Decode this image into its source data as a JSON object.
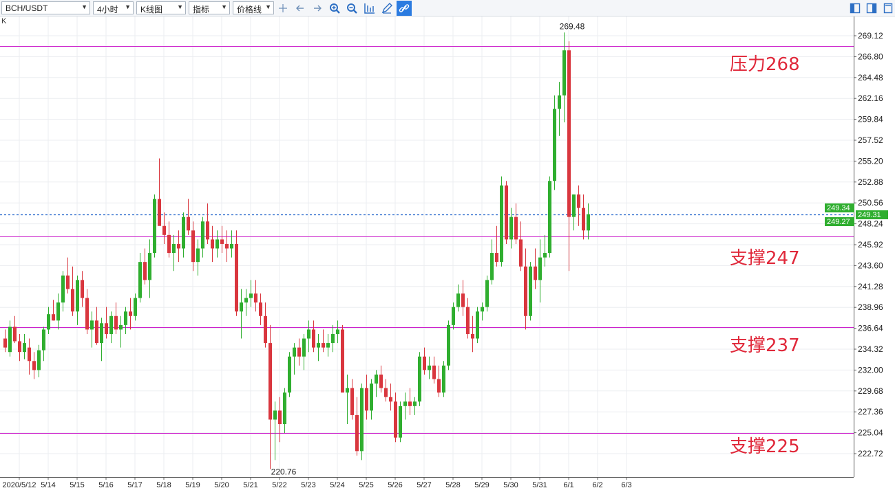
{
  "toolbar": {
    "symbol": "BCH/USDT",
    "interval": "4小时",
    "chart_style": "K线图",
    "indicator": "指标",
    "price_line": "价格线"
  },
  "panel_label": "K",
  "colors": {
    "up": "#2fae2f",
    "down": "#d9363e",
    "hline": "#cc22cc",
    "annotation": "#e0283a",
    "last_price": "#1a5fc9"
  },
  "chart_data": {
    "type": "candlestick",
    "title": "",
    "symbol": "BCH/USDT",
    "interval": "4小时",
    "ylim": [
      220.76,
      270.5
    ],
    "y_ticks": [
      "269.12",
      "266.80",
      "264.48",
      "262.16",
      "259.84",
      "257.52",
      "255.20",
      "252.88",
      "250.56",
      "248.24",
      "245.92",
      "243.60",
      "241.28",
      "238.96",
      "236.64",
      "234.32",
      "232.00",
      "229.68",
      "227.36",
      "225.04",
      "222.72"
    ],
    "x_ticks": [
      {
        "label": "2020/5/12",
        "index": 3
      },
      {
        "label": "5/14",
        "index": 9
      },
      {
        "label": "5/15",
        "index": 15
      },
      {
        "label": "5/16",
        "index": 21
      },
      {
        "label": "5/17",
        "index": 27
      },
      {
        "label": "5/18",
        "index": 33
      },
      {
        "label": "5/19",
        "index": 39
      },
      {
        "label": "5/20",
        "index": 45
      },
      {
        "label": "5/21",
        "index": 51
      },
      {
        "label": "5/22",
        "index": 57
      },
      {
        "label": "5/23",
        "index": 63
      },
      {
        "label": "5/24",
        "index": 69
      },
      {
        "label": "5/25",
        "index": 75
      },
      {
        "label": "5/26",
        "index": 81
      },
      {
        "label": "5/27",
        "index": 87
      },
      {
        "label": "5/28",
        "index": 93
      },
      {
        "label": "5/29",
        "index": 99
      },
      {
        "label": "5/30",
        "index": 105
      },
      {
        "label": "5/31",
        "index": 111
      },
      {
        "label": "6/1",
        "index": 117
      },
      {
        "label": "6/2",
        "index": 123
      },
      {
        "label": "6/3",
        "index": 129
      }
    ],
    "ohlc": [
      [
        235.5,
        236.5,
        234.0,
        234.5
      ],
      [
        234.0,
        237.5,
        233.5,
        236.8
      ],
      [
        236.8,
        238.0,
        235.0,
        235.2
      ],
      [
        235.2,
        236.0,
        233.0,
        234.0
      ],
      [
        234.0,
        236.0,
        233.2,
        235.0
      ],
      [
        234.5,
        235.5,
        231.5,
        233.0
      ],
      [
        233.0,
        234.0,
        231.0,
        232.0
      ],
      [
        232.0,
        234.8,
        231.2,
        234.2
      ],
      [
        234.2,
        236.8,
        233.0,
        236.5
      ],
      [
        236.5,
        239.0,
        236.0,
        238.2
      ],
      [
        238.2,
        239.8,
        237.5,
        237.5
      ],
      [
        237.5,
        240.5,
        236.5,
        239.5
      ],
      [
        239.5,
        243.0,
        238.5,
        242.5
      ],
      [
        242.5,
        244.5,
        240.5,
        241.0
      ],
      [
        241.0,
        243.5,
        238.0,
        238.5
      ],
      [
        238.5,
        242.5,
        237.0,
        242.0
      ],
      [
        242.0,
        243.0,
        239.0,
        240.0
      ],
      [
        240.0,
        241.0,
        236.0,
        236.5
      ],
      [
        236.5,
        238.5,
        234.5,
        237.5
      ],
      [
        237.5,
        239.0,
        234.8,
        235.0
      ],
      [
        235.0,
        237.8,
        233.0,
        237.2
      ],
      [
        237.2,
        239.0,
        235.5,
        236.0
      ],
      [
        236.0,
        238.5,
        235.0,
        238.0
      ],
      [
        238.0,
        239.5,
        236.0,
        236.5
      ],
      [
        236.5,
        238.0,
        234.5,
        237.0
      ],
      [
        237.0,
        239.0,
        236.0,
        238.5
      ],
      [
        238.5,
        240.0,
        236.5,
        238.0
      ],
      [
        238.0,
        240.5,
        237.5,
        240.0
      ],
      [
        240.0,
        245.0,
        239.5,
        244.0
      ],
      [
        244.0,
        245.5,
        241.5,
        242.0
      ],
      [
        242.0,
        246.5,
        240.0,
        245.0
      ],
      [
        245.0,
        251.5,
        244.5,
        251.0
      ],
      [
        251.0,
        255.5,
        249.5,
        248.0
      ],
      [
        248.0,
        249.5,
        246.0,
        247.0
      ],
      [
        247.0,
        248.5,
        244.5,
        245.0
      ],
      [
        245.0,
        247.0,
        243.0,
        246.0
      ],
      [
        246.0,
        247.5,
        244.0,
        245.5
      ],
      [
        245.5,
        249.5,
        244.5,
        249.0
      ],
      [
        249.0,
        251.0,
        247.0,
        247.5
      ],
      [
        247.5,
        248.5,
        243.0,
        244.0
      ],
      [
        244.0,
        246.5,
        242.5,
        245.5
      ],
      [
        245.5,
        249.0,
        244.5,
        248.5
      ],
      [
        248.5,
        250.5,
        246.0,
        246.5
      ],
      [
        246.5,
        248.0,
        244.0,
        245.5
      ],
      [
        245.5,
        247.5,
        244.5,
        246.5
      ],
      [
        246.5,
        248.0,
        245.0,
        246.0
      ],
      [
        246.0,
        247.5,
        244.0,
        245.5
      ],
      [
        245.5,
        247.5,
        244.5,
        246.0
      ],
      [
        246.0,
        247.5,
        238.0,
        238.5
      ],
      [
        238.5,
        241.0,
        235.5,
        239.5
      ],
      [
        239.5,
        241.0,
        238.0,
        240.0
      ],
      [
        240.0,
        242.0,
        239.0,
        240.5
      ],
      [
        240.5,
        242.0,
        238.5,
        239.5
      ],
      [
        239.5,
        240.5,
        237.0,
        238.0
      ],
      [
        238.0,
        239.5,
        234.5,
        235.0
      ],
      [
        235.0,
        237.0,
        221.0,
        226.5
      ],
      [
        226.5,
        228.5,
        222.0,
        227.5
      ],
      [
        227.5,
        229.0,
        224.0,
        226.0
      ],
      [
        226.0,
        230.0,
        225.0,
        229.5
      ],
      [
        229.5,
        234.0,
        229.0,
        233.5
      ],
      [
        233.5,
        235.0,
        231.5,
        234.5
      ],
      [
        234.5,
        235.5,
        232.5,
        233.5
      ],
      [
        233.5,
        236.0,
        232.0,
        235.5
      ],
      [
        235.5,
        237.5,
        234.0,
        236.5
      ],
      [
        236.5,
        237.5,
        234.0,
        234.5
      ],
      [
        234.5,
        236.0,
        233.0,
        235.0
      ],
      [
        235.0,
        236.5,
        234.0,
        234.5
      ],
      [
        234.5,
        236.0,
        233.5,
        235.0
      ],
      [
        235.0,
        237.0,
        234.0,
        236.0
      ],
      [
        236.0,
        237.5,
        235.0,
        236.5
      ],
      [
        236.5,
        237.0,
        230.0,
        229.5
      ],
      [
        229.5,
        231.5,
        226.0,
        230.0
      ],
      [
        230.0,
        231.0,
        226.5,
        227.0
      ],
      [
        227.0,
        229.0,
        222.5,
        223.0
      ],
      [
        223.0,
        230.5,
        222.0,
        230.0
      ],
      [
        230.0,
        231.5,
        226.5,
        227.5
      ],
      [
        227.5,
        231.0,
        226.5,
        230.5
      ],
      [
        230.5,
        232.0,
        229.0,
        231.5
      ],
      [
        231.5,
        232.5,
        229.5,
        230.0
      ],
      [
        230.0,
        231.0,
        228.5,
        229.0
      ],
      [
        229.0,
        230.5,
        227.5,
        228.5
      ],
      [
        228.5,
        229.5,
        224.0,
        224.5
      ],
      [
        224.5,
        228.5,
        224.0,
        228.0
      ],
      [
        228.0,
        229.5,
        226.5,
        228.5
      ],
      [
        228.5,
        230.0,
        227.0,
        228.0
      ],
      [
        228.0,
        229.0,
        227.0,
        228.5
      ],
      [
        228.5,
        234.0,
        228.0,
        233.5
      ],
      [
        233.5,
        234.5,
        231.5,
        232.0
      ],
      [
        232.0,
        233.5,
        231.0,
        232.5
      ],
      [
        232.5,
        233.5,
        230.5,
        231.0
      ],
      [
        231.0,
        232.5,
        229.0,
        229.5
      ],
      [
        229.5,
        233.0,
        229.0,
        232.5
      ],
      [
        232.5,
        237.5,
        232.0,
        237.0
      ],
      [
        237.0,
        239.5,
        236.5,
        239.0
      ],
      [
        239.0,
        241.5,
        238.5,
        240.5
      ],
      [
        240.5,
        242.0,
        238.0,
        239.0
      ],
      [
        239.0,
        240.0,
        235.5,
        236.0
      ],
      [
        236.0,
        238.0,
        234.0,
        235.5
      ],
      [
        235.5,
        239.0,
        235.0,
        238.5
      ],
      [
        238.5,
        239.5,
        237.5,
        239.0
      ],
      [
        239.0,
        242.5,
        238.5,
        242.0
      ],
      [
        242.0,
        246.5,
        241.5,
        245.0
      ],
      [
        245.0,
        248.0,
        243.5,
        244.0
      ],
      [
        244.0,
        253.5,
        243.5,
        252.5
      ],
      [
        252.5,
        253.0,
        246.0,
        246.5
      ],
      [
        246.5,
        250.0,
        245.5,
        249.0
      ],
      [
        249.0,
        250.5,
        246.0,
        246.5
      ],
      [
        246.5,
        248.5,
        243.0,
        243.5
      ],
      [
        243.5,
        245.5,
        236.5,
        238.0
      ],
      [
        238.0,
        244.0,
        237.5,
        243.5
      ],
      [
        243.5,
        245.5,
        241.0,
        242.0
      ],
      [
        242.0,
        246.5,
        239.5,
        244.5
      ],
      [
        244.5,
        247.0,
        243.5,
        245.0
      ],
      [
        245.0,
        253.5,
        244.5,
        253.0
      ],
      [
        253.0,
        262.5,
        252.0,
        261.0
      ],
      [
        261.0,
        264.0,
        258.0,
        262.5
      ],
      [
        262.5,
        269.48,
        259.5,
        267.5
      ],
      [
        267.5,
        268.5,
        243.0,
        249.0
      ],
      [
        249.0,
        251.5,
        247.5,
        251.5
      ],
      [
        251.5,
        252.5,
        248.0,
        250.0
      ],
      [
        250.0,
        251.5,
        246.5,
        247.5
      ],
      [
        247.5,
        250.5,
        246.5,
        249.3
      ]
    ],
    "min_label": "220.76",
    "max_label": "269.48",
    "horizontal_lines": [
      268.0,
      246.8,
      236.8,
      225.0
    ],
    "annotations": [
      {
        "text": "压力268",
        "price": 268
      },
      {
        "text": "支撑247",
        "price": 247
      },
      {
        "text": "支撑237",
        "price": 237
      },
      {
        "text": "支撑225",
        "price": 225
      }
    ],
    "price_tags": [
      {
        "label": "249.34",
        "value": 249.34,
        "color": "#2fae2f"
      },
      {
        "label": "249.31",
        "value": 249.31,
        "color": "#2fae2f"
      },
      {
        "label": "249.27",
        "value": 249.27,
        "color": "#2fae2f"
      }
    ],
    "last_price_line": 249.31
  }
}
